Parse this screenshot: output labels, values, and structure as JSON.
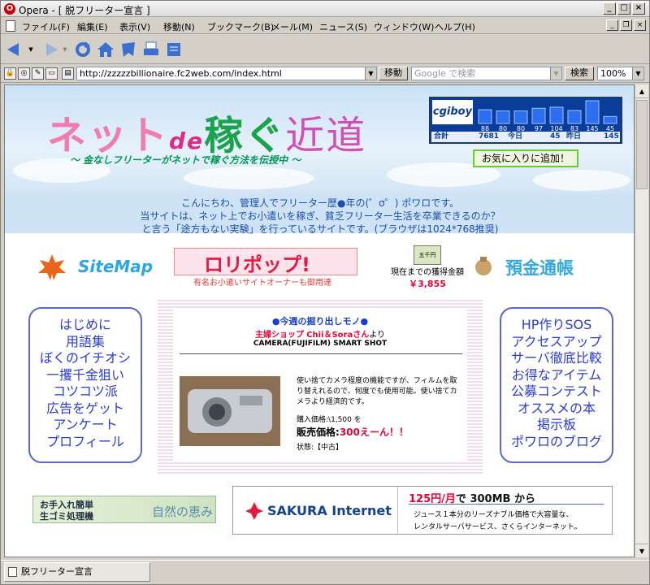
{
  "window": {
    "title": "Opera - [ 脱フリーター宣言 ]",
    "icon": "opera-icon"
  },
  "menu": [
    "ファイル(F)",
    "編集(E)",
    "表示(V)",
    "移動(N)",
    "ブックマーク(B)",
    "メール(M)",
    "ニュース(S)",
    "ウィンドウ(W)",
    "ヘルプ(H)"
  ],
  "address": {
    "url": "http://zzzzzbillionaire.fc2web.com/index.html",
    "go": "移動",
    "search_placeholder": "Google で検索",
    "search": "検索",
    "zoom": "100%"
  },
  "site": {
    "logo_a": "ネット",
    "logo_de": "de",
    "logo_b": "稼ぐ",
    "logo_c": "近道",
    "subtitle": "～ 金なしフリーターがネットで稼ぐ方法を伝授中 ～",
    "counter": {
      "brand": "cgiboy",
      "bars": [
        88,
        80,
        80,
        97,
        104,
        83,
        145,
        45
      ],
      "total_label": "合計",
      "total": "7681",
      "today_label": "今日",
      "today": "45",
      "yesterday_label": "昨日",
      "yesterday": "145"
    },
    "favorite": "お気に入りに追加！",
    "intro": [
      "こんにちわ、管理人でフリーター歴●年の(゜σ゜) ポワロです。",
      "当サイトは、ネット上でお小遣いを稼ぎ、貧乏フリーター生活を卒業できるのか？",
      "と言う「途方もない実験」を行っているサイトです。(ブラウザは1024*768推奨)"
    ],
    "sitemap": "SiteMap",
    "lollipop": "ロリポップ!",
    "lollipop_caption": "有名お小遣いサイトオーナーも御用達",
    "money": {
      "note": "五千円",
      "label": "現在までの獲得金額",
      "value": "￥3,855"
    },
    "bankbook": "預金通帳",
    "left_nav": [
      "はじめに",
      "用語集",
      "ぼくのイチオシ",
      "一攫千金狙い",
      "コツコツ派",
      "広告をゲット",
      "アンケート",
      "プロフィール"
    ],
    "right_nav": [
      "HP作りSOS",
      "アクセスアップ",
      "サーバ徹底比較",
      "お得なアイテム",
      "公募コンテスト",
      "オススメの本",
      "掲示板",
      "ポワロのブログ"
    ],
    "feature": {
      "heading": "●今週の掘り出しモノ●",
      "shop_prefix": "主婦ショップ",
      "shop_name": "Chii＆Soraさん",
      "shop_suffix": "より",
      "product": "CAMERA(FUJIFILM) SMART SHOT",
      "desc": "使い捨てカメラ程度の機能ですが、フィルムを取り替えれるので、何度でも使用可能。使い捨てカメラより経済的です。",
      "buy_price": "購入価格:\\1,500 を",
      "sale_label": "販売価格:",
      "sale_value": "300えーん！！",
      "state": "状態:【中古】"
    },
    "banner_left": {
      "a": "お手入れ簡単",
      "b": "生ゴミ処理機",
      "c": "自然の恵み"
    },
    "sakura": {
      "brand": "SAKURA Internet",
      "price": "125円",
      "per": "/月",
      "mid": "で",
      "cap": "300MB から",
      "line1": "ジュース１本分のリーズナブル価格で大容量な、",
      "line2": "レンタルサーバサービス、さくらインターネット。"
    }
  },
  "statusbar": {
    "tab": "脱フリーター宣言"
  }
}
